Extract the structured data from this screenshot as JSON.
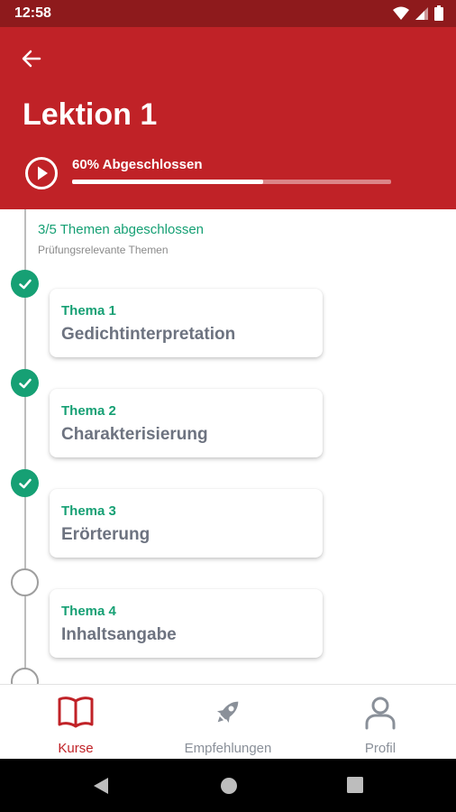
{
  "status_bar": {
    "time": "12:58",
    "icons": [
      "wifi-icon",
      "signal-icon",
      "battery-icon"
    ]
  },
  "header": {
    "back_icon": "arrow-left-icon",
    "title": "Lektion 1",
    "progress_label": "60% Abgeschlossen",
    "progress_fraction": 0.6
  },
  "content": {
    "topics_count": "3/5 Themen abgeschlossen",
    "topics_subtitle": "Prüfungsrelevante Themen",
    "topics": [
      {
        "label": "Thema 1",
        "title": "Gedichtinterpretation",
        "completed": true
      },
      {
        "label": "Thema 2",
        "title": "Charakterisierung",
        "completed": true
      },
      {
        "label": "Thema 3",
        "title": "Erörterung",
        "completed": true
      },
      {
        "label": "Thema 4",
        "title": "Inhaltsangabe",
        "completed": false
      }
    ]
  },
  "bottom_nav": {
    "items": [
      {
        "label": "Kurse",
        "icon": "book-icon",
        "active": true
      },
      {
        "label": "Empfehlungen",
        "icon": "rocket-icon",
        "active": false
      },
      {
        "label": "Profil",
        "icon": "person-icon",
        "active": false
      }
    ]
  },
  "colors": {
    "header": "#c02227",
    "status_bar": "#8e1a1c",
    "accent_green": "#16a074",
    "nav_active": "#c02227",
    "nav_inactive": "#8a9099"
  }
}
